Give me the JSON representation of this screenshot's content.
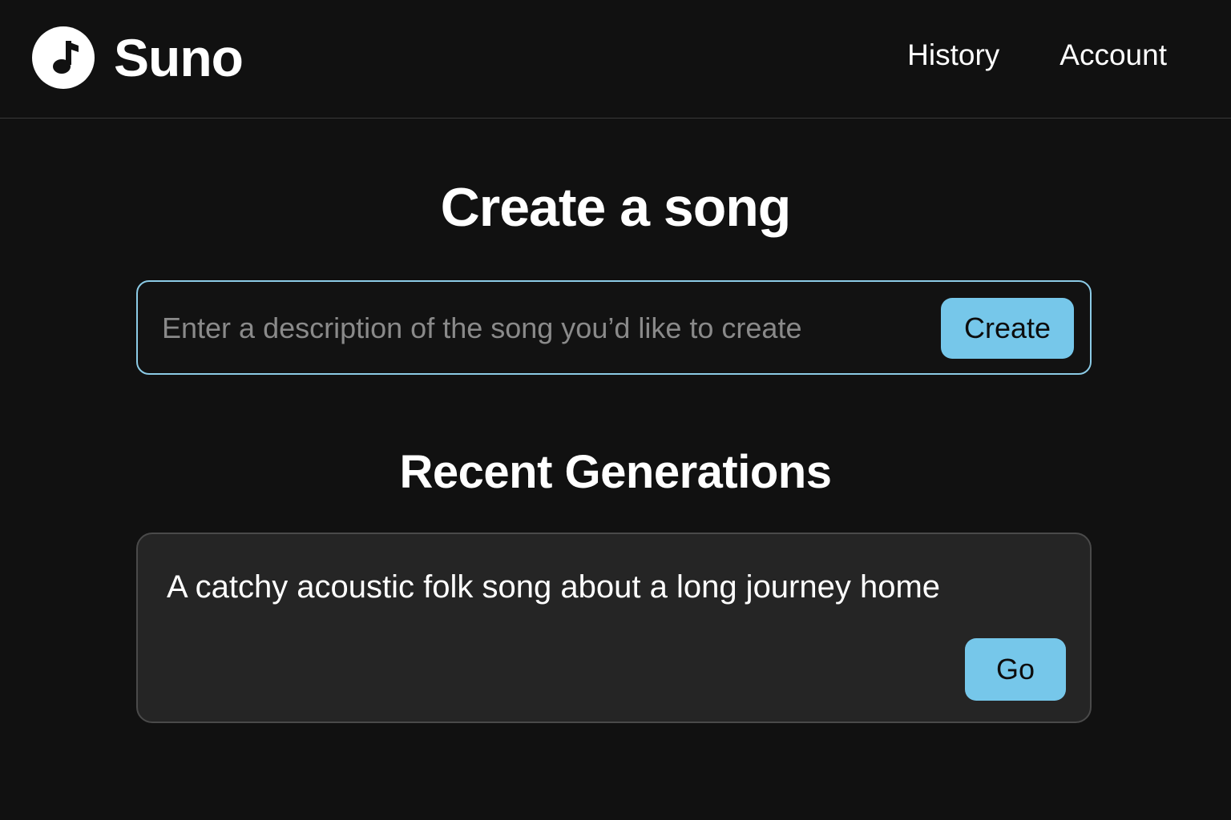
{
  "header": {
    "logo_text": "Suno",
    "logo_icon": "music-note-icon",
    "nav": [
      {
        "label": "History"
      },
      {
        "label": "Account"
      }
    ]
  },
  "main": {
    "title": "Create a song",
    "prompt": {
      "placeholder": "Enter a description of the song you’d like to create",
      "value": "",
      "button_label": "Create"
    },
    "recent": {
      "title": "Recent Generations",
      "items": [
        {
          "text": "A catchy acoustic folk song about a long journey home",
          "button_label": "Go"
        }
      ]
    }
  },
  "colors": {
    "background": "#111111",
    "accent": "#76c7ea",
    "input_border": "#8ccbe6",
    "card_background": "#252525"
  }
}
